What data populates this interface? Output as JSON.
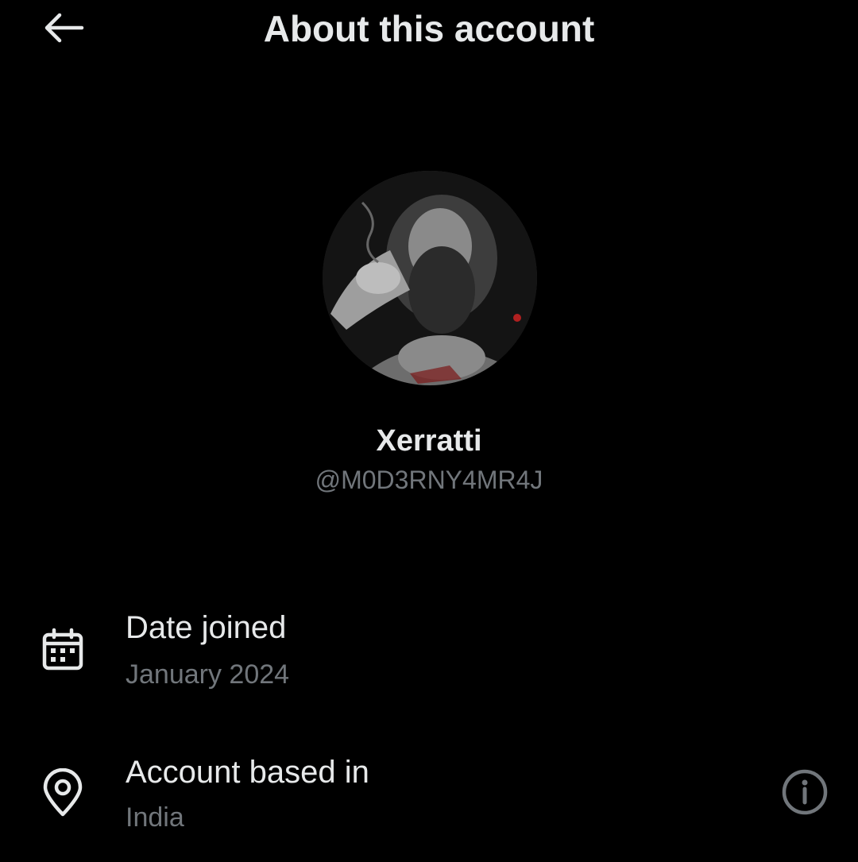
{
  "header": {
    "title": "About this account",
    "back_icon": "arrow-left-icon"
  },
  "profile": {
    "display_name": "Xerratti",
    "handle": "@M0D3RNY4MR4J"
  },
  "details": {
    "date_joined": {
      "icon": "calendar-icon",
      "label": "Date joined",
      "value": "January 2024"
    },
    "account_based_in": {
      "icon": "location-pin-icon",
      "label": "Account based in",
      "value": "India",
      "info_icon": "info-icon"
    }
  },
  "colors": {
    "background": "#000000",
    "primary_text": "#e7e9ea",
    "secondary_text": "#71767b"
  }
}
